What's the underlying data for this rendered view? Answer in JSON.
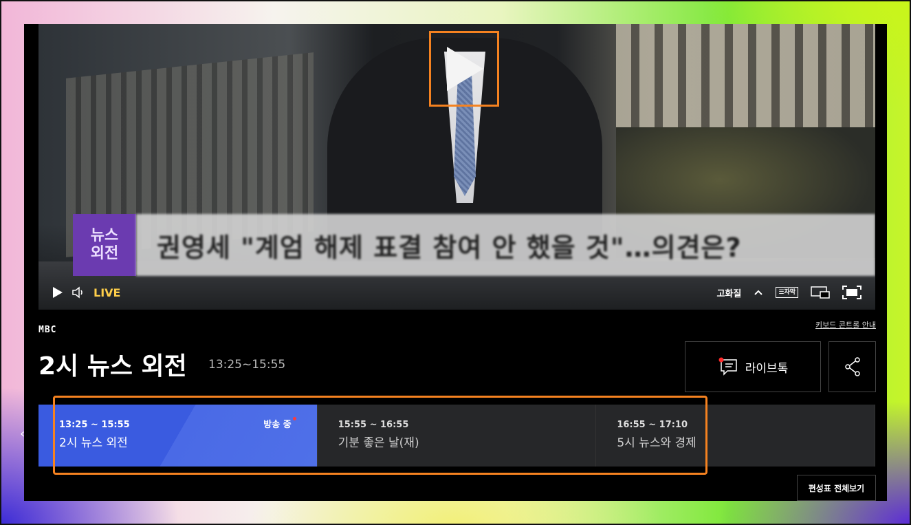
{
  "player": {
    "caption_badge_line1": "뉴스",
    "caption_badge_line2": "외전",
    "caption_text": "권영세 \"계엄 해제 표결 참여 안 했을 것\"…의견은?",
    "live_label": "LIVE",
    "quality_label": "고화질",
    "subtitle_label": "자막",
    "icons": [
      "play-icon",
      "volume-icon",
      "chevron-up-icon",
      "subtitle-icon",
      "pip-icon",
      "fullscreen-icon"
    ]
  },
  "program": {
    "channel": "MBC",
    "keyboard_guide": "키보드 콘트롤 안내",
    "title": "2시 뉴스 외전",
    "time": "13:25~15:55",
    "livetalk_label": "라이브톡",
    "icons": [
      "chat-icon",
      "share-icon"
    ]
  },
  "schedule": {
    "onair_label": "방송 중",
    "items": [
      {
        "time": "13:25 ~ 15:55",
        "name": "2시 뉴스 외전"
      },
      {
        "time": "15:55 ~ 16:55",
        "name": "기분 좋은 날(재)"
      },
      {
        "time": "16:55 ~ 17:10",
        "name": "5시 뉴스와 경제"
      }
    ],
    "full_schedule_label": "편성표 전체보기",
    "prev_arrow": "‹"
  },
  "colors": {
    "accent_orange": "#f58220",
    "current_blue": "#3a5be0",
    "live_yellow": "#ffcf4a",
    "onair_dot": "#ff3b3b"
  }
}
